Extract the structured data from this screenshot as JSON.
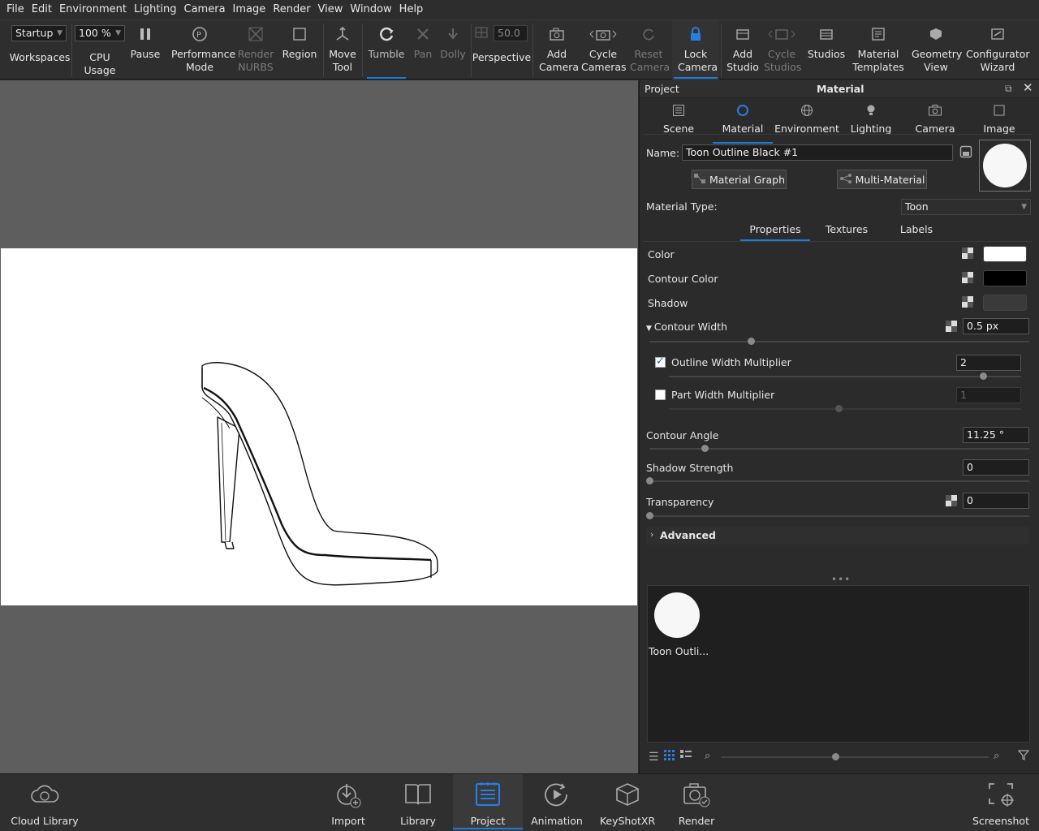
{
  "menu": [
    "File",
    "Edit",
    "Environment",
    "Lighting",
    "Camera",
    "Image",
    "Render",
    "View",
    "Window",
    "Help"
  ],
  "toolbar": {
    "workspace_value": "Startup",
    "workspaces_label": "Workspaces",
    "cpu_value": "100 %",
    "cpu_label": "CPU Usage",
    "pause": "Pause",
    "performance_mode": "Performance Mode",
    "render_nurbs": "Render NURBS",
    "region": "Region",
    "move_tool": "Move Tool",
    "tumble": "Tumble",
    "pan": "Pan",
    "dolly": "Dolly",
    "fov_value": "50.0",
    "perspective": "Perspective",
    "add_camera": "Add Camera",
    "cycle_cameras": "Cycle Cameras",
    "reset_camera": "Reset Camera",
    "lock_camera": "Lock Camera",
    "add_studio": "Add Studio",
    "cycle_studios": "Cycle Studios",
    "studios": "Studios",
    "material_templates": "Material Templates",
    "geometry_view": "Geometry View",
    "configurator_wizard": "Configurator Wizard"
  },
  "panel": {
    "header_left": "Project",
    "header_title": "Material",
    "tabs": [
      "Scene",
      "Material",
      "Environment",
      "Lighting",
      "Camera",
      "Image"
    ],
    "name_label": "Name:",
    "name_value": "Toon Outline Black #1",
    "material_graph": "Material Graph",
    "multi_material": "Multi-Material",
    "material_type_label": "Material Type:",
    "material_type_value": "Toon",
    "subtabs": [
      "Properties",
      "Textures",
      "Labels"
    ],
    "color_label": "Color",
    "contour_color_label": "Contour Color",
    "shadow_label": "Shadow",
    "contour_width_label": "Contour Width",
    "contour_width_value": "0.5 px",
    "outline_width_label": "Outline Width Multiplier",
    "outline_width_value": "2",
    "part_width_label": "Part Width Multiplier",
    "part_width_value": "1",
    "contour_angle_label": "Contour Angle",
    "contour_angle_value": "11.25 °",
    "shadow_strength_label": "Shadow Strength",
    "shadow_strength_value": "0",
    "transparency_label": "Transparency",
    "transparency_value": "0",
    "advanced_label": "Advanced",
    "library_item_label": "Toon Outli...",
    "colors": {
      "color": "#ffffff",
      "contour_color": "#000000",
      "shadow": "#3a3a3a"
    }
  },
  "bottombar": {
    "cloud_library": "Cloud Library",
    "import": "Import",
    "library": "Library",
    "project": "Project",
    "animation": "Animation",
    "keyshotxr": "KeyShotXR",
    "render": "Render",
    "screenshot": "Screenshot"
  }
}
